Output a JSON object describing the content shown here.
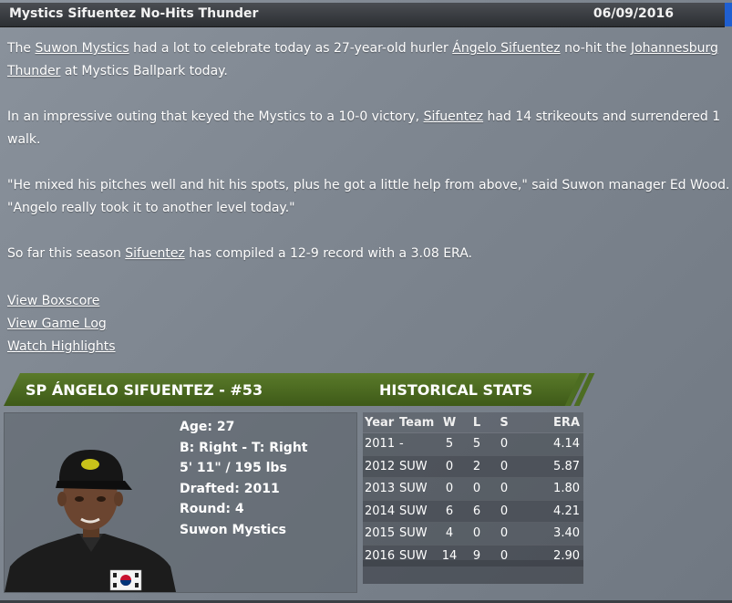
{
  "header": {
    "title": "Mystics Sifuentez No-Hits Thunder",
    "date": "06/09/2016"
  },
  "article": {
    "p1": {
      "t1": "The ",
      "team": "Suwon Mystics",
      "t2": " had a lot to celebrate today as 27-year-old hurler ",
      "player": "Ángelo Sifuentez",
      "t3": " no-hit the ",
      "opponent": "Johannesburg Thunder",
      "t4": " at Mystics Ballpark today."
    },
    "p2": {
      "t1": "In an impressive outing that keyed the Mystics to a 10-0 victory, ",
      "player": "Sifuentez",
      "t2": " had 14 strikeouts and surrendered 1 walk."
    },
    "p3": "\"He mixed his pitches well and hit his spots, plus he got a little help from above,\" said Suwon manager Ed Wood. \"Angelo really took it to another level today.\"",
    "p4": {
      "t1": "So far this season ",
      "player": "Sifuentez",
      "t2": " has compiled a 12-9 record with a 3.08 ERA."
    }
  },
  "links": {
    "boxscore": "View Boxscore",
    "gamelog": "View Game Log",
    "highlights": "Watch Highlights"
  },
  "player": {
    "header": "SP ÁNGELO SIFUENTEZ - #53",
    "age": "Age: 27",
    "bats_throws": "B: Right - T: Right",
    "height_weight": "5' 11\" / 195 lbs",
    "drafted": "Drafted: 2011",
    "round": "Round: 4",
    "team": "Suwon Mystics"
  },
  "stats": {
    "title": "HISTORICAL STATS",
    "columns": [
      "Year",
      "Team",
      "W",
      "L",
      "S",
      "ERA"
    ],
    "rows": [
      [
        "2011",
        "-",
        "5",
        "5",
        "0",
        "4.14"
      ],
      [
        "2012",
        "SUW",
        "0",
        "2",
        "0",
        "5.87"
      ],
      [
        "2013",
        "SUW",
        "0",
        "0",
        "0",
        "1.80"
      ],
      [
        "2014",
        "SUW",
        "6",
        "6",
        "0",
        "4.21"
      ],
      [
        "2015",
        "SUW",
        "4",
        "0",
        "0",
        "3.40"
      ],
      [
        "2016",
        "SUW",
        "14",
        "9",
        "0",
        "2.90"
      ]
    ]
  },
  "colors": {
    "header_green": "#4a6a20",
    "title_bar": "#2c2f33",
    "accent_blue": "#1f5fd1"
  }
}
